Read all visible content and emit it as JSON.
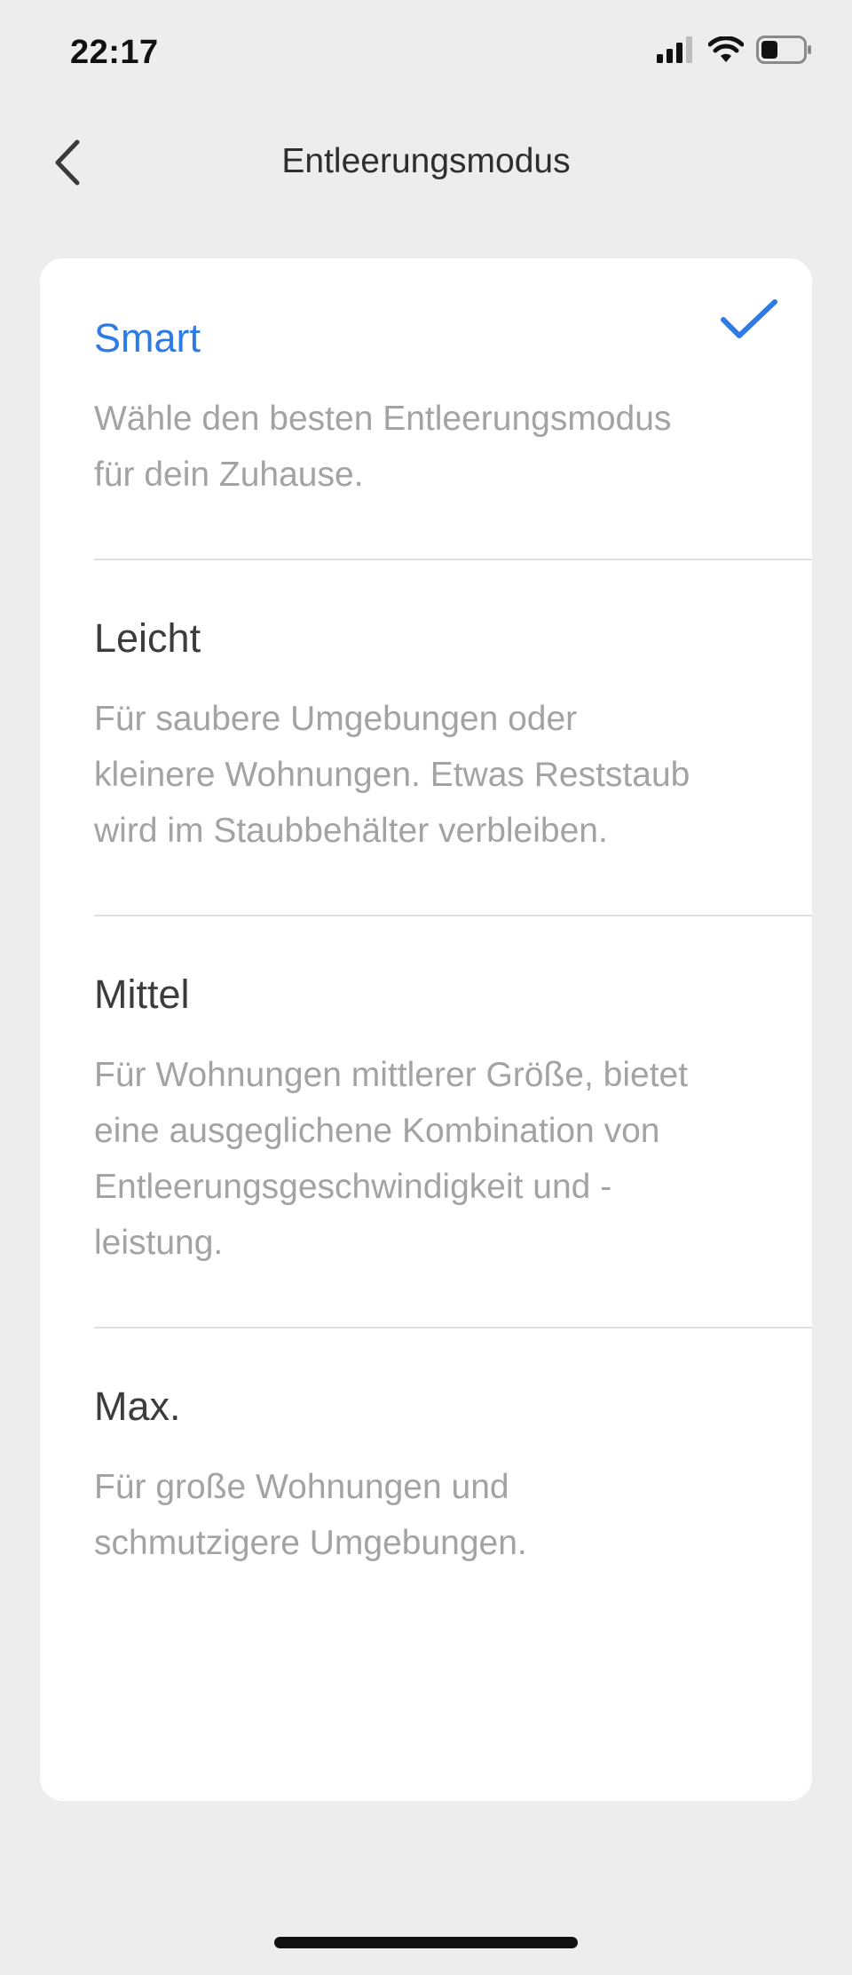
{
  "status_bar": {
    "time": "22:17",
    "icons": [
      "cellular-signal-icon",
      "wifi-icon",
      "battery-icon"
    ],
    "battery_level": 0.4
  },
  "header": {
    "title": "Entleerungsmodus",
    "back_icon": "chevron-left-icon"
  },
  "options": [
    {
      "title": "Smart",
      "description": "Wähle den besten Entleerungsmodus für dein Zuhause.",
      "selected": true
    },
    {
      "title": "Leicht",
      "description": "Für saubere Umgebungen oder kleinere Wohnungen. Etwas Reststaub wird im Staubbehälter verbleiben.",
      "selected": false
    },
    {
      "title": "Mittel",
      "description": "Für Wohnungen mittlerer Größe, bietet eine ausgeglichene Kombination von Entleerungsgeschwindigkeit und -leistung.",
      "selected": false
    },
    {
      "title": "Max.",
      "description": "Für große Wohnungen und schmutzigere Umgebungen.",
      "selected": false
    }
  ],
  "colors": {
    "accent": "#2f7be5",
    "background": "#ededed",
    "card": "#ffffff",
    "secondary_text": "#a3a3a3"
  }
}
